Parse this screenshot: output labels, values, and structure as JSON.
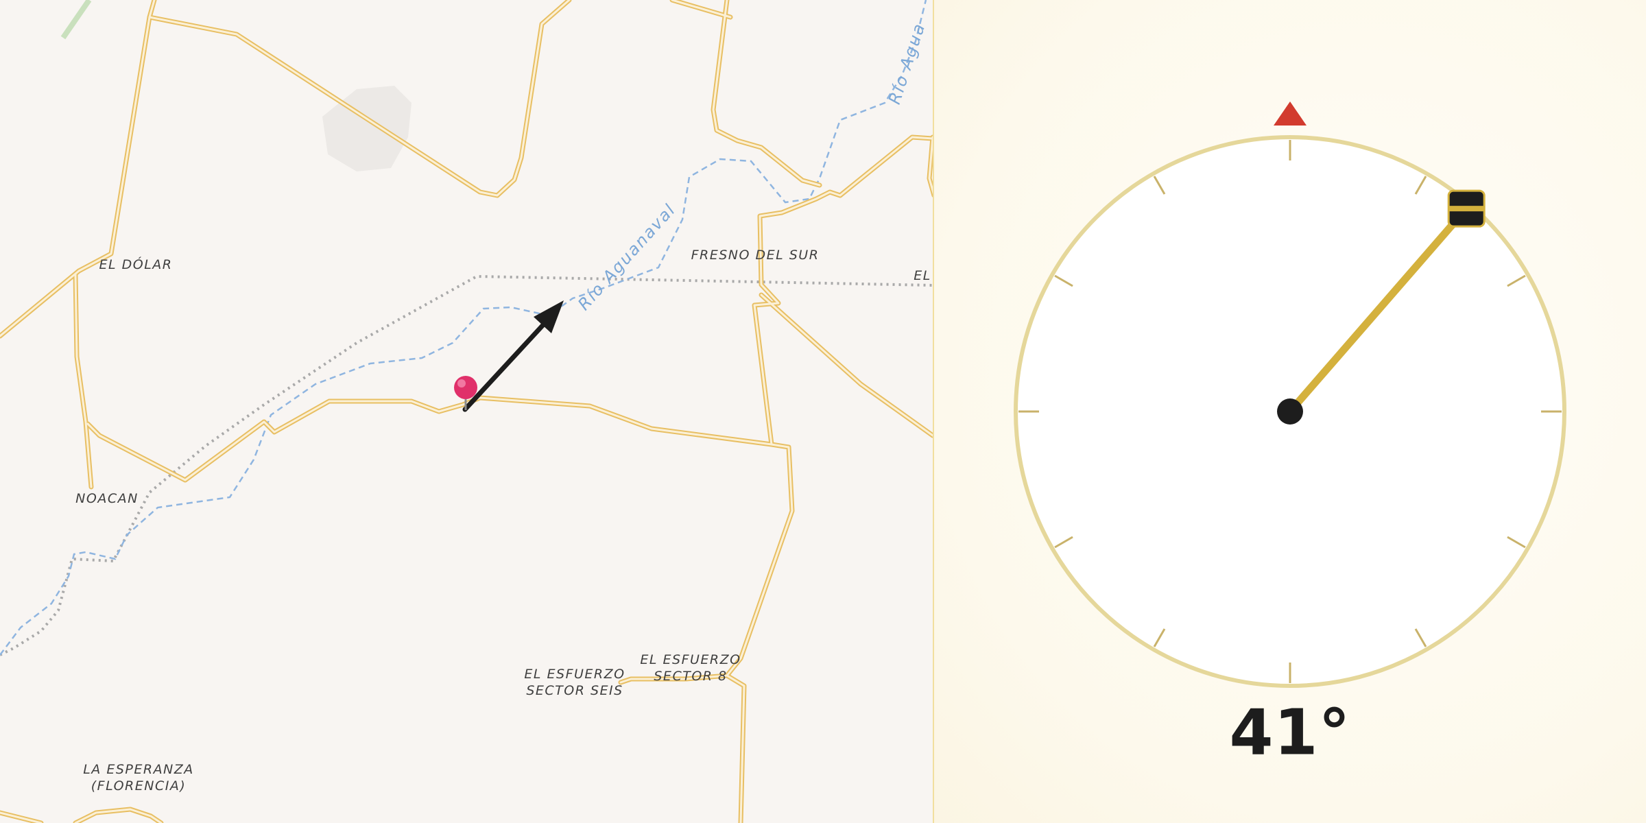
{
  "map": {
    "places": [
      {
        "id": "el-dolar",
        "name": "EL DÓLAR"
      },
      {
        "id": "fresno-del-sur",
        "name": "FRESNO DEL SUR"
      },
      {
        "id": "el-east",
        "name": "EL"
      },
      {
        "id": "noacan",
        "name": "NOACAN"
      },
      {
        "id": "el-esfuerzo-sector-seis",
        "name": "EL ESFUERZO\nSECTOR SEIS"
      },
      {
        "id": "el-esfuerzo-sector-8",
        "name": "EL ESFUERZO\nSECTOR 8"
      },
      {
        "id": "la-esperanza",
        "name": "LA ESPERANZA\n(FLORENCIA)"
      }
    ],
    "river_label": "Río Aguanaval",
    "river_label_ne": "Río Agua",
    "marker_icon": "location-pin-icon",
    "direction_arrow_icon": "direction-arrow-icon",
    "colors": {
      "road": "#f3d28a",
      "river": "#8fb5e0",
      "boundary": "#a9a9a9",
      "pin": "#e0306a",
      "arrow": "#1d1d1d"
    }
  },
  "compass": {
    "bearing_deg": 41,
    "readout": "41°",
    "north_marker_icon": "north-triangle-icon",
    "needle_icon": "bearing-needle-icon",
    "colors": {
      "ring": "#e5d79a",
      "needle": "#d4b13d",
      "north_marker": "#d23b2e",
      "hub": "#1d1d1d"
    }
  }
}
